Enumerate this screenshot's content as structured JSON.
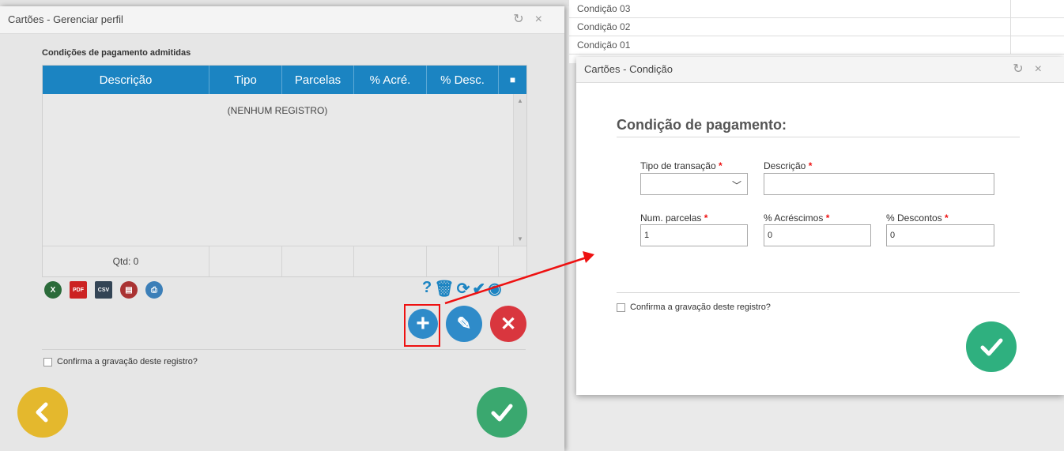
{
  "background_list": {
    "rows": [
      "Condição 03",
      "Condição 02",
      "Condição 01"
    ]
  },
  "left_dialog": {
    "title": "Cartões - Gerenciar perfil",
    "section_label": "Condições de pagamento admitidas",
    "grid": {
      "columns": [
        "Descrição",
        "Tipo",
        "Parcelas",
        "% Acré.",
        "% Desc.",
        "■"
      ],
      "empty_message": "(NENHUM REGISTRO)",
      "footer_count": "Qtd: 0"
    },
    "export_icons": [
      "excel-icon",
      "pdf-icon",
      "csv-icon",
      "report-icon",
      "print-icon"
    ],
    "grid_tools": [
      "help-icon",
      "trash-icon",
      "refresh-icon",
      "check-icon",
      "eye-icon"
    ],
    "actions": [
      "add-icon",
      "edit-icon",
      "delete-icon"
    ],
    "confirm_label": "Confirma a gravação deste registro?",
    "colors": {
      "header": "#1b84c2",
      "add": "#2f8bc9",
      "edit": "#2f8bc9",
      "delete": "#d9363e",
      "back": "#e4b82d",
      "ok": "#3aa86f"
    }
  },
  "right_dialog": {
    "title": "Cartões - Condição",
    "form_title": "Condição de pagamento:",
    "fields": {
      "tipo_transacao": {
        "label": "Tipo de transação",
        "value": ""
      },
      "descricao": {
        "label": "Descrição",
        "value": ""
      },
      "num_parcelas": {
        "label": "Num. parcelas",
        "value": "1"
      },
      "acrescimos": {
        "label": "% Acréscimos",
        "value": "0"
      },
      "descontos": {
        "label": "% Descontos",
        "value": "0"
      }
    },
    "required_mark": "*",
    "confirm_label": "Confirma a gravação deste registro?"
  }
}
